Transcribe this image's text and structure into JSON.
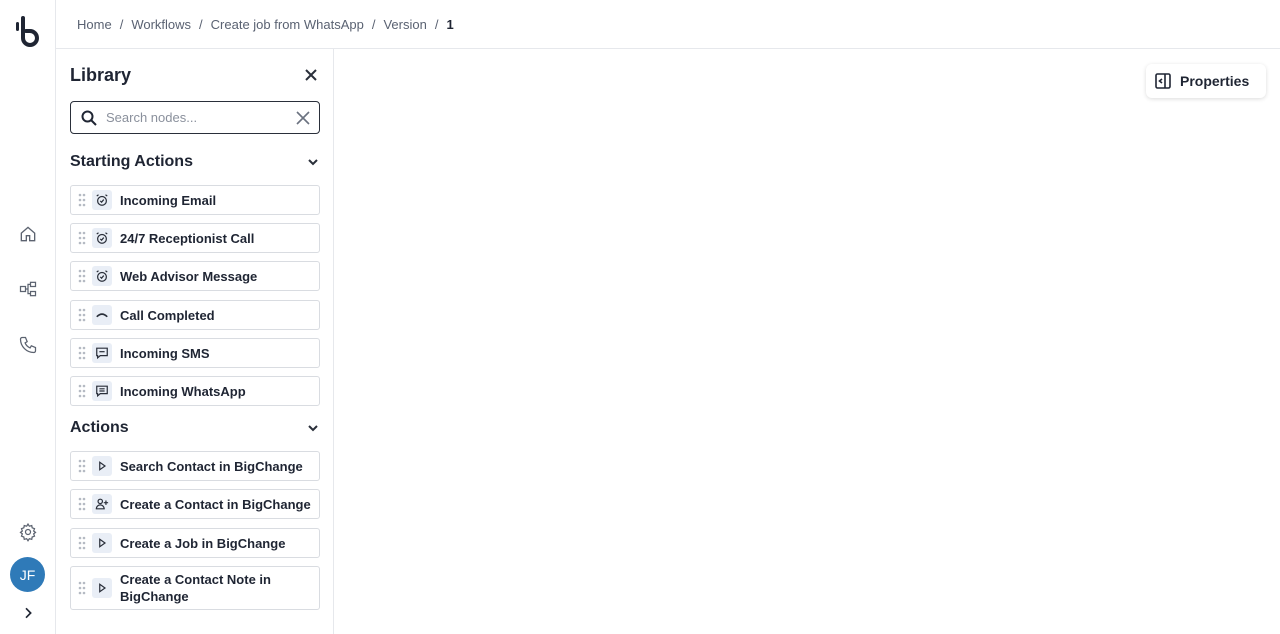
{
  "breadcrumb": {
    "items": [
      "Home",
      "Workflows",
      "Create job from WhatsApp",
      "Version"
    ],
    "current": "1",
    "separator": "/"
  },
  "user": {
    "initials": "JF",
    "avatar_color": "#2f7ab8"
  },
  "library": {
    "title": "Library",
    "search": {
      "placeholder": "Search nodes...",
      "value": ""
    },
    "sections": [
      {
        "title": "Starting Actions",
        "items": [
          {
            "label": "Incoming Email",
            "icon": "alarm-clock-icon"
          },
          {
            "label": "24/7 Receptionist Call",
            "icon": "alarm-clock-icon"
          },
          {
            "label": "Web Advisor Message",
            "icon": "alarm-clock-icon"
          },
          {
            "label": "Call Completed",
            "icon": "phone-hangup-icon"
          },
          {
            "label": "Incoming SMS",
            "icon": "chat-bubble-icon"
          },
          {
            "label": "Incoming WhatsApp",
            "icon": "chat-text-icon"
          }
        ]
      },
      {
        "title": "Actions",
        "items": [
          {
            "label": "Search Contact in BigChange",
            "icon": "play-icon"
          },
          {
            "label": "Create a Contact in BigChange",
            "icon": "user-add-icon"
          },
          {
            "label": "Create a Job in BigChange",
            "icon": "play-icon"
          },
          {
            "label": "Create a Contact Note in BigChange",
            "icon": "play-icon"
          }
        ]
      }
    ]
  },
  "canvas": {
    "properties_label": "Properties"
  }
}
